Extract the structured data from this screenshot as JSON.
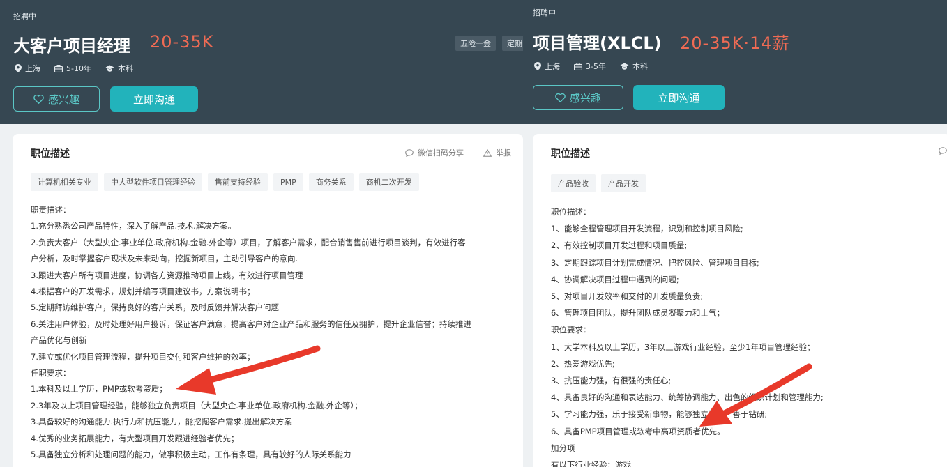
{
  "left": {
    "status": "招聘中",
    "title": "大客户项目经理",
    "salary": "20-35K",
    "location": "上海",
    "experience": "5-10年",
    "education": "本科",
    "benefits": [
      "五险一金",
      "定期"
    ],
    "interest_label": "感兴趣",
    "chat_label": "立即沟通",
    "section_title": "职位描述",
    "share_label": "微信扫码分享",
    "report_label": "举报",
    "tags": [
      "计算机相关专业",
      "中大型软件项目管理经验",
      "售前支持经验",
      "PMP",
      "商务关系",
      "商机二次开发"
    ],
    "lines": [
      "职责描述：",
      "1.充分熟悉公司产品特性，深入了解产品.技术.解决方案。",
      "2.负责大客户（大型央企.事业单位.政府机构.金融.外企等）项目，了解客户需求，配合销售售前进行项目谈判，有效进行客",
      "户分析，及时掌握客户现状及未来动向，挖掘新项目，主动引导客户的意向.",
      "3.跟进大客户所有项目进度，协调各方资源推动项目上线，有效进行项目管理",
      "4.根据客户的开发需求，规划并编写项目建议书，方案说明书；",
      "5.定期拜访维护客户，保持良好的客户关系，及时反馈并解决客户问题",
      "6.关注用户体验，及时处理好用户投诉，保证客户满意，提高客户对企业产品和服务的信任及拥护，提升企业信誉；持续推进",
      "产品优化与创新",
      "7.建立或优化项目管理流程，提升项目交付和客户维护的效率；",
      "任职要求：",
      "1.本科及以上学历，PMP或软考资质；",
      "2.3年及以上项目管理经验，能够独立负责项目（大型央企.事业单位.政府机构.金融.外企等）；",
      "3.具备较好的沟通能力.执行力和抗压能力，能挖掘客户需求.提出解决方案",
      "4.优秀的业务拓展能力，有大型项目开发跟进经验者优先；",
      "5.具备独立分析和处理问题的能力，做事积极主动，工作有条理，具有较好的人际关系能力"
    ]
  },
  "right": {
    "status": "招聘中",
    "title": "项目管理(XLCL)",
    "salary": "20-35K·14薪",
    "location": "上海",
    "experience": "3-5年",
    "education": "本科",
    "interest_label": "感兴趣",
    "chat_label": "立即沟通",
    "section_title": "职位描述",
    "tags": [
      "产品验收",
      "产品开发"
    ],
    "lines": [
      "职位描述：",
      "1、能够全程管理项目开发流程，识别和控制项目风险;",
      "2、有效控制项目开发过程和项目质量;",
      "3、定期跟踪项目计划完成情况、把控风险、管理项目目标;",
      "4、协调解决项目过程中遇到的问题;",
      "5、对项目开发效率和交付的开发质量负责;",
      "6、管理项目团队，提升团队成员凝聚力和士气；",
      "职位要求：",
      "1、大学本科及以上学历，3年以上游戏行业经验，至少1年项目管理经验；",
      "2、热爱游戏优先;",
      "3、抗压能力强，有很强的责任心;",
      "4、具备良好的沟通和表达能力、统筹协调能力、出色的组织计划和管理能力;",
      "5、学习能力强，乐于接受新事物，能够独立思考，善于钻研;",
      "6、具备PMP项目管理或软考中高项资质者优先。",
      "加分项",
      "有以下行业经验：游戏"
    ]
  },
  "colors": {
    "header_bg": "#364752",
    "salary": "#ef6b54",
    "accent": "#22b3bb",
    "arrow": "#e8392a"
  }
}
